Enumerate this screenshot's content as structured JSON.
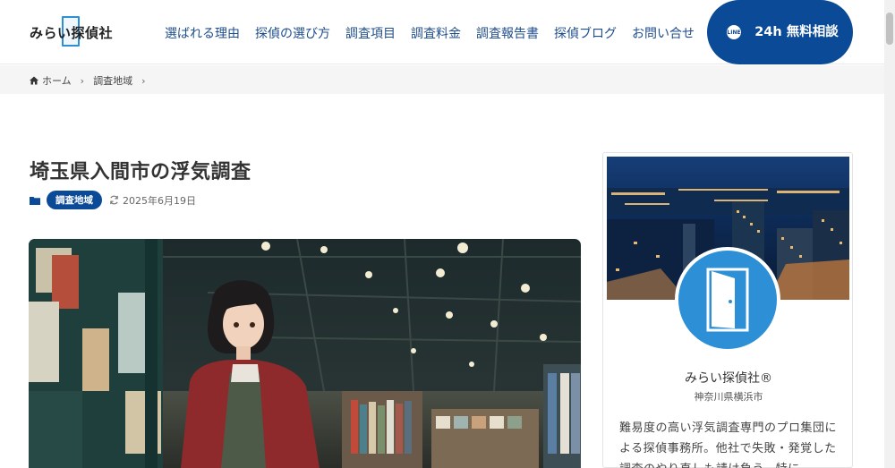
{
  "header": {
    "logo_text": "みらい探偵社",
    "nav": [
      "選ばれる理由",
      "探偵の選び方",
      "調査項目",
      "調査料金",
      "調査報告書",
      "探偵ブログ",
      "お問い合せ"
    ],
    "cta_icon": "LINE",
    "cta_label": "24h 無料相談"
  },
  "breadcrumb": {
    "home": "ホーム",
    "category": "調査地域"
  },
  "article": {
    "title": "埼玉県入間市の浮気調査",
    "category": "調査地域",
    "date": "2025年6月19日"
  },
  "profile": {
    "name": "みらい探偵社®",
    "location": "神奈川県横浜市",
    "description": "難易度の高い浮気調査専門のプロ集団による探偵事務所。他社で失敗・発覚した調査のやり直しも請け負う。特に"
  },
  "colors": {
    "brand": "#0b4a97",
    "accent": "#2d8fd6"
  }
}
